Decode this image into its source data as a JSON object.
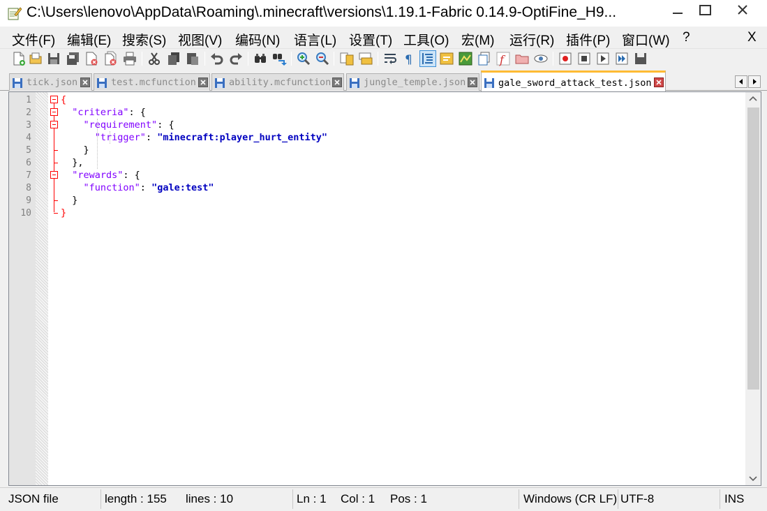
{
  "window": {
    "title": "C:\\Users\\lenovo\\AppData\\Roaming\\.minecraft\\versions\\1.19.1-Fabric 0.14.9-OptiFine_H9..."
  },
  "menu": {
    "items": [
      {
        "label": "文件(F)"
      },
      {
        "label": "编辑(E)"
      },
      {
        "label": "搜索(S)"
      },
      {
        "label": "视图(V)"
      },
      {
        "label": "编码(N)"
      },
      {
        "label": "语言(L)"
      },
      {
        "label": "设置(T)"
      },
      {
        "label": "工具(O)"
      },
      {
        "label": "宏(M)"
      },
      {
        "label": "运行(R)"
      },
      {
        "label": "插件(P)"
      },
      {
        "label": "窗口(W)"
      },
      {
        "label": "?"
      }
    ],
    "close_label": "X"
  },
  "toolbar": {
    "buttons": [
      "new-file-icon",
      "open-file-icon",
      "save-icon",
      "save-all-icon",
      "close-icon",
      "close-all-icon",
      "print-icon",
      "cut-icon",
      "copy-icon",
      "paste-icon",
      "undo-icon",
      "redo-icon",
      "find-icon",
      "replace-icon",
      "zoom-in-icon",
      "zoom-out-icon",
      "sync-vertical-icon",
      "sync-horizontal-icon",
      "word-wrap-icon",
      "show-all-chars-icon",
      "indent-guide-icon",
      "user-lang-icon",
      "doc-map-icon",
      "doc-list-icon",
      "function-list-icon",
      "folder-workspace-icon",
      "monitoring-icon",
      "record-macro-icon",
      "stop-macro-icon",
      "play-macro-icon",
      "run-macro-multiple-icon",
      "save-macro-icon"
    ]
  },
  "tabs": [
    {
      "label": "tick.json",
      "active": false
    },
    {
      "label": "test.mcfunction",
      "active": false
    },
    {
      "label": "ability.mcfunction",
      "active": false
    },
    {
      "label": "jungle_temple.json",
      "active": false
    },
    {
      "label": "gale_sword_attack_test.json",
      "active": true
    }
  ],
  "editor": {
    "line_numbers": [
      "1",
      "2",
      "3",
      "4",
      "5",
      "6",
      "7",
      "8",
      "9",
      "10"
    ],
    "lines": [
      {
        "parts": [
          {
            "t": "{",
            "c": "brace-red"
          }
        ]
      },
      {
        "parts": [
          {
            "t": "  "
          },
          {
            "t": "\"criteria\"",
            "c": "key"
          },
          {
            "t": ": {"
          }
        ]
      },
      {
        "parts": [
          {
            "t": "    "
          },
          {
            "t": "\"requirement\"",
            "c": "key"
          },
          {
            "t": ": {"
          }
        ]
      },
      {
        "parts": [
          {
            "t": "      "
          },
          {
            "t": "\"trigger\"",
            "c": "key"
          },
          {
            "t": ": "
          },
          {
            "t": "\"minecraft:player_hurt_entity\"",
            "c": "str"
          }
        ]
      },
      {
        "parts": [
          {
            "t": "    }"
          }
        ]
      },
      {
        "parts": [
          {
            "t": "  },"
          }
        ]
      },
      {
        "parts": [
          {
            "t": "  "
          },
          {
            "t": "\"rewards\"",
            "c": "key"
          },
          {
            "t": ": {"
          }
        ]
      },
      {
        "parts": [
          {
            "t": "    "
          },
          {
            "t": "\"function\"",
            "c": "key"
          },
          {
            "t": ": "
          },
          {
            "t": "\"gale:test\"",
            "c": "str"
          }
        ]
      },
      {
        "parts": [
          {
            "t": "  }"
          }
        ]
      },
      {
        "parts": [
          {
            "t": "}",
            "c": "brace-red"
          }
        ]
      }
    ]
  },
  "status": {
    "file_type": "JSON file",
    "length": "length : 155",
    "lines": "lines : 10",
    "ln": "Ln : 1",
    "col": "Col : 1",
    "pos": "Pos : 1",
    "eol": "Windows (CR LF)",
    "encoding": "UTF-8",
    "mode": "INS"
  },
  "colors": {
    "key": "#8000ff",
    "string": "#0000c0",
    "brace": "#ff0000",
    "current_line": "#e8e8ff",
    "active_tab_accent": "#ffbb33"
  }
}
